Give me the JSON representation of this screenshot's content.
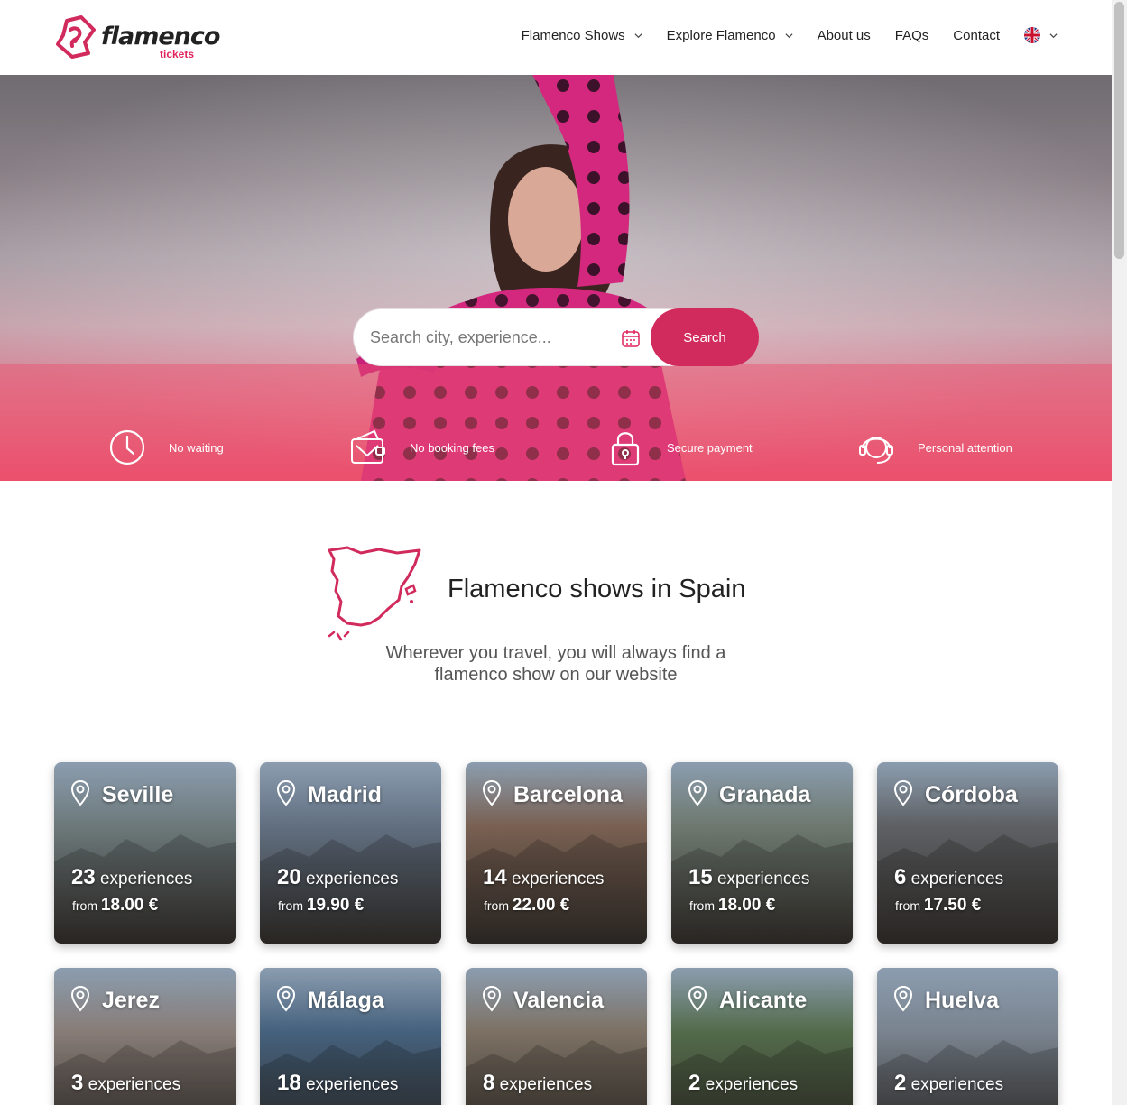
{
  "brand": {
    "name": "flamenco",
    "sub": "tickets",
    "accent": "#d12a5c"
  },
  "nav": {
    "items": [
      {
        "label": "Flamenco Shows",
        "has_dropdown": true
      },
      {
        "label": "Explore Flamenco",
        "has_dropdown": true
      },
      {
        "label": "About us",
        "has_dropdown": false
      },
      {
        "label": "FAQs",
        "has_dropdown": false
      },
      {
        "label": "Contact",
        "has_dropdown": false
      }
    ],
    "language_icon": "uk-flag-icon"
  },
  "hero": {
    "search": {
      "placeholder": "Search city, experience...",
      "button_label": "Search",
      "calendar_icon": "calendar-icon"
    },
    "features": [
      {
        "icon": "clock-icon",
        "label": "No waiting"
      },
      {
        "icon": "wallet-icon",
        "label": "No booking fees"
      },
      {
        "icon": "lock-icon",
        "label": "Secure payment"
      },
      {
        "icon": "headset-icon",
        "label": "Personal attention"
      }
    ]
  },
  "section": {
    "title": "Flamenco shows in Spain",
    "subtitle": "Wherever you travel, you will always find a flamenco show on our website"
  },
  "cities": [
    {
      "name": "Seville",
      "count": "23",
      "exp_label": "experiences",
      "from_label": "from",
      "price": "18.00 €",
      "color": "#7c8a8c"
    },
    {
      "name": "Madrid",
      "count": "20",
      "exp_label": "experiences",
      "from_label": "from",
      "price": "19.90 €",
      "color": "#6f7f93"
    },
    {
      "name": "Barcelona",
      "count": "14",
      "exp_label": "experiences",
      "from_label": "from",
      "price": "22.00 €",
      "color": "#8a6e5e"
    },
    {
      "name": "Granada",
      "count": "15",
      "exp_label": "experiences",
      "from_label": "from",
      "price": "18.00 €",
      "color": "#7d8a7f"
    },
    {
      "name": "Córdoba",
      "count": "6",
      "exp_label": "experiences",
      "from_label": "from",
      "price": "17.50 €",
      "color": "#6b6e72"
    },
    {
      "name": "Jerez",
      "count": "3",
      "exp_label": "experiences",
      "from_label": "",
      "price": "",
      "color": "#9b8e88"
    },
    {
      "name": "Málaga",
      "count": "18",
      "exp_label": "experiences",
      "from_label": "",
      "price": "",
      "color": "#4f6f8f"
    },
    {
      "name": "Valencia",
      "count": "8",
      "exp_label": "experiences",
      "from_label": "",
      "price": "",
      "color": "#8e8172"
    },
    {
      "name": "Alicante",
      "count": "2",
      "exp_label": "experiences",
      "from_label": "",
      "price": "",
      "color": "#5f7a55"
    },
    {
      "name": "Huelva",
      "count": "2",
      "exp_label": "experiences",
      "from_label": "",
      "price": "",
      "color": "#8b96a3"
    }
  ]
}
